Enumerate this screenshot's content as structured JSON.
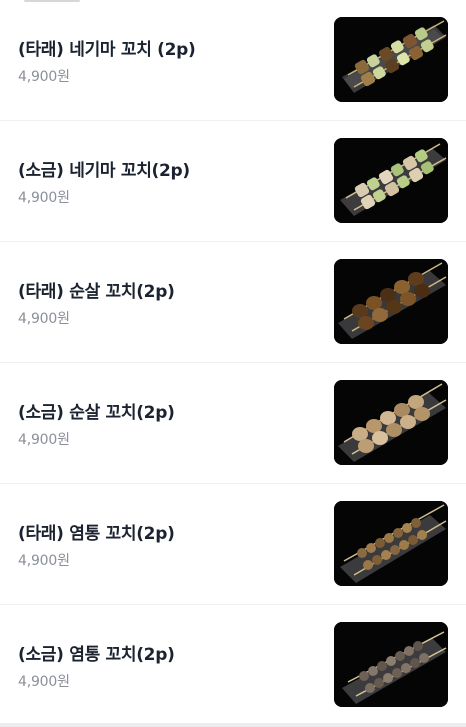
{
  "menu": {
    "items": [
      {
        "name": "(타래) 네기마 꼬치 (2p)",
        "price": "4,900원",
        "thumb": "negima-skewer-tare"
      },
      {
        "name": "(소금) 네기마 꼬치(2p)",
        "price": "4,900원",
        "thumb": "negima-skewer-salt"
      },
      {
        "name": "(타래) 순살 꼬치(2p)",
        "price": "4,900원",
        "thumb": "chicken-skewer-tare"
      },
      {
        "name": "(소금) 순살 꼬치(2p)",
        "price": "4,900원",
        "thumb": "chicken-skewer-salt"
      },
      {
        "name": "(타래) 염통 꼬치(2p)",
        "price": "4,900원",
        "thumb": "heart-skewer-tare"
      },
      {
        "name": "(소금) 염통 꼬치(2p)",
        "price": "4,900원",
        "thumb": "heart-skewer-salt"
      }
    ]
  },
  "colors": {
    "name_text": "#1c2330",
    "price_text": "#8b9099",
    "divider": "#eeeff1",
    "photo_background": "#050505"
  }
}
